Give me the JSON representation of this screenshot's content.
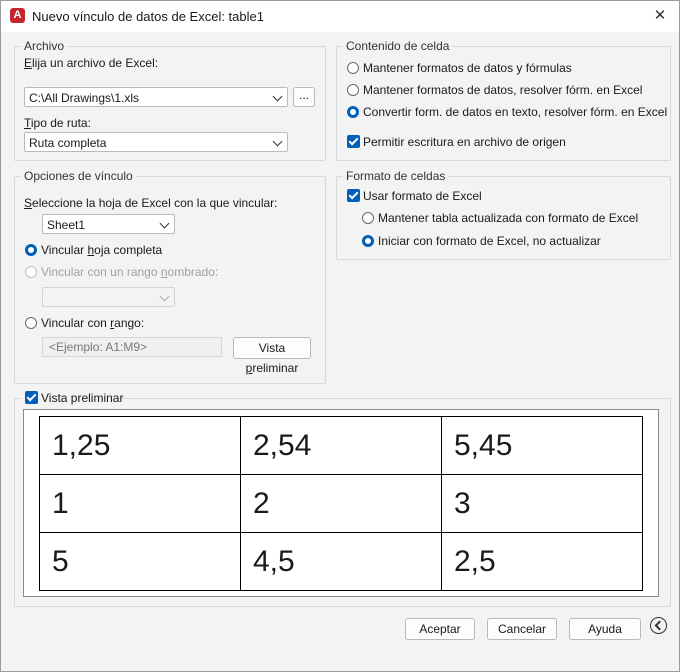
{
  "window": {
    "title": "Nuevo vínculo de datos de Excel: table1",
    "app_icon_letter": "A",
    "close_glyph": "✕"
  },
  "archivo": {
    "title": "Archivo",
    "choose_prefix": "E",
    "choose_rest": "lija un archivo de Excel:",
    "file_value": "C:\\All Drawings\\1.xls",
    "browse_label": "...",
    "path_type_prefix": "T",
    "path_type_rest": "ipo de ruta:",
    "path_type_value": "Ruta completa"
  },
  "contenido": {
    "title": "Contenido de celda",
    "opt1": "Mantener formatos de datos y fórmulas",
    "opt2": "Mantener formatos de datos, resolver fórm. en Excel",
    "opt3": "Convertir form. de datos en texto, resolver fórm. en Excel",
    "allow_write": "Permitir escritura en archivo de origen"
  },
  "opciones": {
    "title": "Opciones de vínculo",
    "select_sheet_prefix": "S",
    "select_sheet_rest": "eleccione la hoja de Excel con la que vincular:",
    "sheet_value": "Sheet1",
    "link_whole_a": "Vincular ",
    "link_whole_u": "h",
    "link_whole_b": "oja completa",
    "link_named_a": "Vincular con un rango ",
    "link_named_u": "n",
    "link_named_b": "ombrado:",
    "link_range_a": "Vincular con ",
    "link_range_u": "r",
    "link_range_b": "ango:",
    "range_placeholder": "<Ejemplo: A1:M9>",
    "preview_btn_a": "Vista ",
    "preview_btn_u": "p",
    "preview_btn_b": "reliminar"
  },
  "formato": {
    "title": "Formato de celdas",
    "use_excel": "Usar formato de Excel",
    "keep_updated": "Mantener tabla actualizada con formato de Excel",
    "start_excel": "Iniciar con formato de Excel, no actualizar"
  },
  "preview": {
    "title": "Vista preliminar",
    "rows": [
      [
        "1,25",
        "2,54",
        "5,45"
      ],
      [
        "1",
        "2",
        "3"
      ],
      [
        "5",
        "4,5",
        "2,5"
      ]
    ]
  },
  "footer": {
    "accept": "Aceptar",
    "cancel": "Cancelar",
    "help": "Ayuda"
  }
}
